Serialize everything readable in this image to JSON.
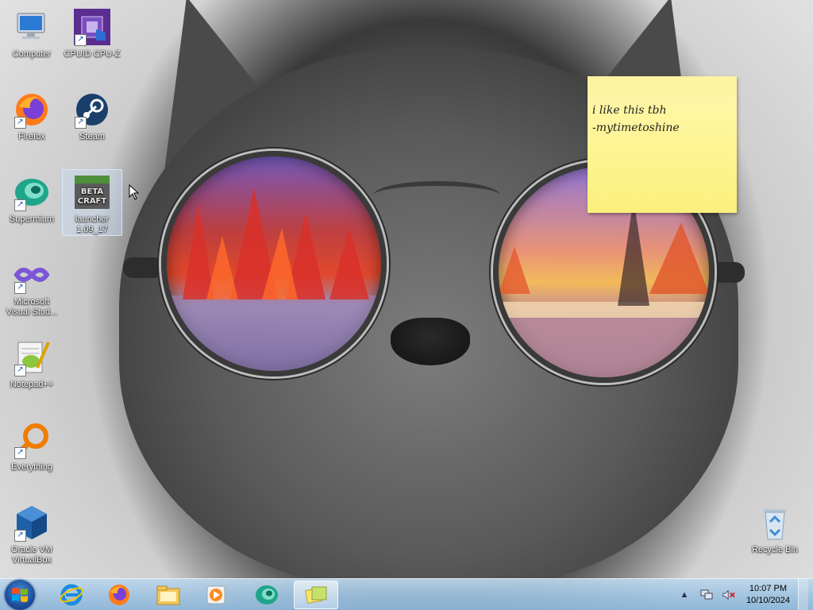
{
  "desktop_icons": [
    {
      "label": "Computer",
      "icon": "computer-icon"
    },
    {
      "label": "CPUID CPU-Z",
      "icon": "cpuz-icon"
    },
    {
      "label": "Firefox",
      "icon": "firefox-icon"
    },
    {
      "label": "Steam",
      "icon": "steam-icon"
    },
    {
      "label": "Supermium",
      "icon": "supermium-icon"
    },
    {
      "label": "launcher 1.09_17",
      "icon": "betacraft-icon"
    },
    {
      "label": "Microsoft Visual Stud...",
      "icon": "visual-studio-icon"
    },
    {
      "label": "Notepad++",
      "icon": "notepadpp-icon"
    },
    {
      "label": "Everything",
      "icon": "everything-icon"
    },
    {
      "label": "Oracle VM VirtualBox",
      "icon": "virtualbox-icon"
    },
    {
      "label": "Recycle Bin",
      "icon": "recycle-bin-icon"
    }
  ],
  "betacraft_logo_text": "BETA CRAFT",
  "sticky_note": {
    "line1": "i like this tbh",
    "line2": "-mytimetoshine"
  },
  "taskbar": {
    "pinned": [
      {
        "name": "internet-explorer-icon"
      },
      {
        "name": "firefox-icon"
      },
      {
        "name": "file-explorer-icon"
      },
      {
        "name": "media-player-icon"
      },
      {
        "name": "supermium-icon"
      },
      {
        "name": "sticky-notes-icon"
      }
    ],
    "clock_time": "10:07 PM",
    "clock_date": "10/10/2024"
  },
  "colors": {
    "taskbar": "#a9c9e4",
    "sticky": "#fbf07c",
    "selection": "#c8dcf5"
  }
}
